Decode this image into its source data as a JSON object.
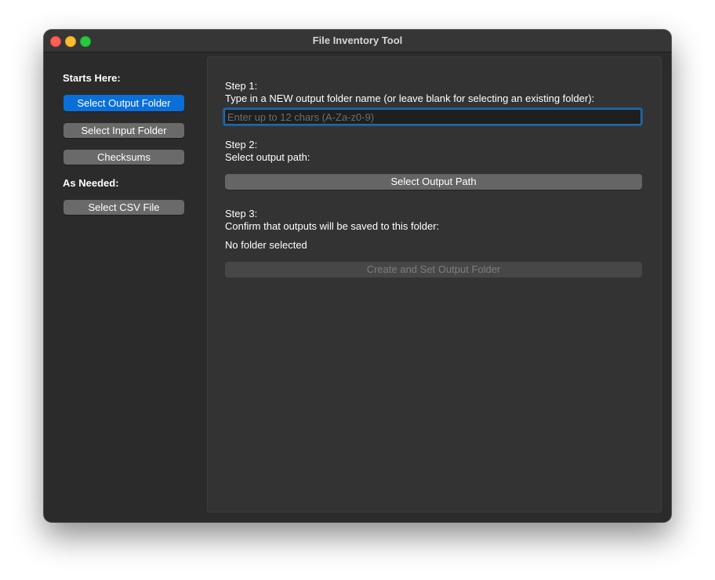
{
  "window": {
    "title": "File Inventory Tool"
  },
  "sidebar": {
    "section_starts": "Starts Here:",
    "buttons_main": [
      {
        "label": "Select Output Folder",
        "selected": true
      },
      {
        "label": "Select Input Folder"
      },
      {
        "label": "Checksums"
      }
    ],
    "section_as_needed": "As Needed:",
    "buttons_extra": [
      {
        "label": "Select CSV File"
      }
    ]
  },
  "main": {
    "step1_title": "Step 1:",
    "step1_desc": "Type in a NEW output folder name (or leave blank for selecting an existing folder):",
    "folder_name_input": {
      "value": "",
      "placeholder": "Enter up to 12 chars (A-Za-z0-9)"
    },
    "step2_title": "Step 2:",
    "step2_desc": "Select output path:",
    "select_output_path_label": "Select Output Path",
    "step3_title": "Step 3:",
    "step3_desc": "Confirm that outputs will be saved to this folder:",
    "selected_folder_text": "No folder selected",
    "create_button_label": "Create and Set Output Folder",
    "create_button_enabled": false
  },
  "colors": {
    "accent": "#0a6fd8",
    "window_bg": "#2b2b2b",
    "panel_bg": "#333333"
  }
}
